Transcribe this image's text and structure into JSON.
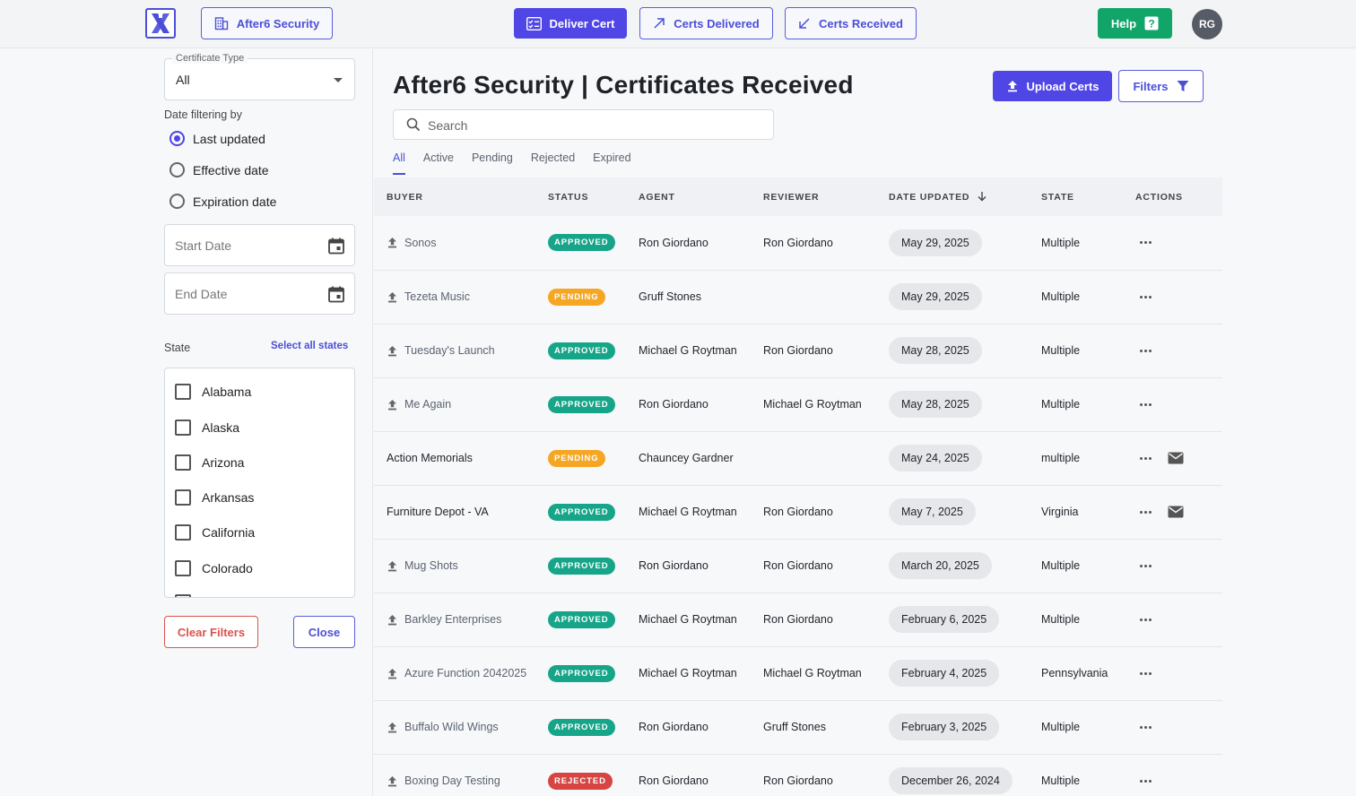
{
  "topbar": {
    "org_button": "After6 Security",
    "deliver_cert": "Deliver Cert",
    "certs_delivered": "Certs Delivered",
    "certs_received": "Certs Received",
    "help": "Help",
    "avatar_initials": "RG"
  },
  "sidebar": {
    "certificate_type_label": "Certificate Type",
    "certificate_type_value": "All",
    "date_filter_label": "Date filtering by",
    "date_options": [
      "Last updated",
      "Effective date",
      "Expiration date"
    ],
    "date_option_selected": "Last updated",
    "start_date_placeholder": "Start Date",
    "end_date_placeholder": "End Date",
    "state_label": "State",
    "select_all_states": "Select all states",
    "states": [
      "Alabama",
      "Alaska",
      "Arizona",
      "Arkansas",
      "California",
      "Colorado"
    ],
    "clear_filters": "Clear Filters",
    "close": "Close"
  },
  "main": {
    "title": "After6 Security | Certificates Received",
    "upload_certs": "Upload Certs",
    "filters": "Filters",
    "search_placeholder": "Search",
    "tabs": [
      "All",
      "Active",
      "Pending",
      "Rejected",
      "Expired"
    ],
    "active_tab": "All",
    "columns": [
      "BUYER",
      "STATUS",
      "AGENT",
      "REVIEWER",
      "DATE UPDATED",
      "STATE",
      "ACTIONS"
    ],
    "rows": [
      {
        "buyer": "Sonos",
        "uploaded": true,
        "status": "APPROVED",
        "agent": "Ron Giordano",
        "reviewer": "Ron Giordano",
        "date": "May 29, 2025",
        "state": "Multiple",
        "mail": false
      },
      {
        "buyer": "Tezeta Music",
        "uploaded": true,
        "status": "PENDING",
        "agent": "Gruff Stones",
        "reviewer": "",
        "date": "May 29, 2025",
        "state": "Multiple",
        "mail": false
      },
      {
        "buyer": "Tuesday's Launch",
        "uploaded": true,
        "status": "APPROVED",
        "agent": "Michael G Roytman",
        "reviewer": "Ron Giordano",
        "date": "May 28, 2025",
        "state": "Multiple",
        "mail": false
      },
      {
        "buyer": "Me Again",
        "uploaded": true,
        "status": "APPROVED",
        "agent": "Ron Giordano",
        "reviewer": "Michael G Roytman",
        "date": "May 28, 2025",
        "state": "Multiple",
        "mail": false
      },
      {
        "buyer": "Action Memorials",
        "uploaded": false,
        "status": "PENDING",
        "agent": "Chauncey Gardner",
        "reviewer": "",
        "date": "May 24, 2025",
        "state": "multiple",
        "mail": true
      },
      {
        "buyer": "Furniture Depot - VA",
        "uploaded": false,
        "status": "APPROVED",
        "agent": "Michael G Roytman",
        "reviewer": "Ron Giordano",
        "date": "May 7, 2025",
        "state": "Virginia",
        "mail": true
      },
      {
        "buyer": "Mug Shots",
        "uploaded": true,
        "status": "APPROVED",
        "agent": "Ron Giordano",
        "reviewer": "Ron Giordano",
        "date": "March 20, 2025",
        "state": "Multiple",
        "mail": false
      },
      {
        "buyer": "Barkley Enterprises",
        "uploaded": true,
        "status": "APPROVED",
        "agent": "Michael G Roytman",
        "reviewer": "Ron Giordano",
        "date": "February 6, 2025",
        "state": "Multiple",
        "mail": false
      },
      {
        "buyer": "Azure Function 2042025",
        "uploaded": true,
        "status": "APPROVED",
        "agent": "Michael G Roytman",
        "reviewer": "Michael G Roytman",
        "date": "February 4, 2025",
        "state": "Pennsylvania",
        "mail": false
      },
      {
        "buyer": "Buffalo Wild Wings",
        "uploaded": true,
        "status": "APPROVED",
        "agent": "Ron Giordano",
        "reviewer": "Gruff Stones",
        "date": "February 3, 2025",
        "state": "Multiple",
        "mail": false
      },
      {
        "buyer": "Boxing Day Testing",
        "uploaded": true,
        "status": "REJECTED",
        "agent": "Ron Giordano",
        "reviewer": "Ron Giordano",
        "date": "December 26, 2024",
        "state": "Multiple",
        "mail": false
      }
    ]
  },
  "colors": {
    "accent": "#4f46e5",
    "approved": "#17a589",
    "pending": "#f5a623",
    "rejected": "#d64541",
    "help": "#12a56a"
  },
  "icons": {
    "org": "building-icon",
    "deliver": "checklist-icon",
    "delivered": "arrow-up-right-icon",
    "received": "arrow-down-left-icon",
    "help": "question-icon",
    "upload": "upload-icon",
    "filters": "funnel-icon",
    "search": "search-icon",
    "calendar": "calendar-icon",
    "mail": "mail-icon",
    "more": "more-dots-icon"
  }
}
